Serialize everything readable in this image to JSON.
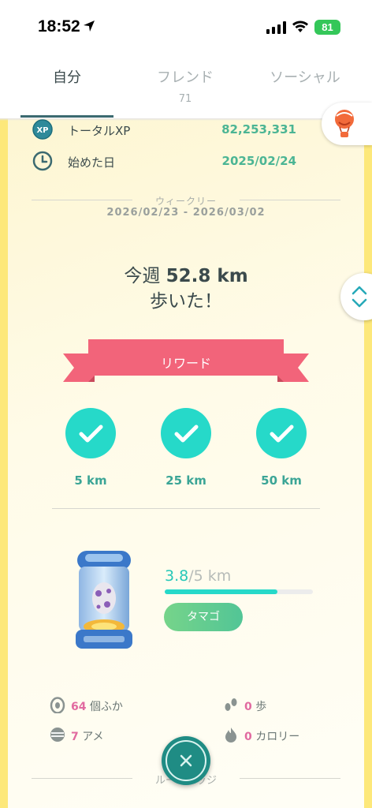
{
  "status_bar": {
    "time": "18:52",
    "battery": "81"
  },
  "tabs": [
    {
      "label": "自分",
      "count": ""
    },
    {
      "label": "フレンド",
      "count": "71"
    },
    {
      "label": "ソーシャル",
      "count": ""
    }
  ],
  "stats": {
    "total_xp_label": "トータルXP",
    "total_xp_value": "82,253,331",
    "start_date_label": "始めた日",
    "start_date_value": "2025/02/24",
    "xp_icon_text": "XP"
  },
  "weekly": {
    "label": "ウィークリー",
    "range": "2026/02/23 - 2026/03/02",
    "prefix": "今週 ",
    "distance": "52.8 km",
    "suffix": "歩いた！"
  },
  "reward": {
    "label": "リワード",
    "milestones": [
      "5 km",
      "25 km",
      "50 km"
    ]
  },
  "egg": {
    "current": "3.8",
    "total": "/5 km",
    "progress": 0.76,
    "button_label": "タマゴ"
  },
  "summary": {
    "hatched_num": "64",
    "hatched_label": " 個ふか",
    "candy_num": "7",
    "candy_label": " アメ",
    "steps_num": "0",
    "steps_label": " 歩",
    "calories_num": "0",
    "calories_label": " カロリー"
  },
  "route_label": "ルートバッジ",
  "colors": {
    "teal": "#26d9c9",
    "green_value": "#4bb594",
    "ribbon": "#f2647a",
    "pink_num": "#e16aa0"
  }
}
